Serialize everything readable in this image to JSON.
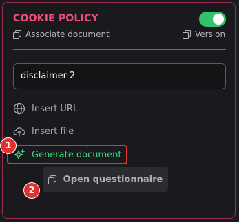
{
  "panel": {
    "title": "COOKIE POLICY",
    "toggle_on": true,
    "associate_label": "Associate document",
    "version_label": "Version",
    "document_value": "disclaimer-2"
  },
  "actions": {
    "insert_url": "Insert URL",
    "insert_file": "Insert file",
    "generate": "Generate document",
    "open_questionnaire": "Open questionnaire"
  },
  "annotations": {
    "badge_1": "1",
    "badge_2": "2"
  },
  "colors": {
    "title": "#ee4d7c",
    "toggle": "#34c26c",
    "generate": "#3fd779",
    "highlight": "#e3312f"
  },
  "icons": {
    "associate": "copy-icon",
    "version": "copy-icon",
    "insert_url": "globe-icon",
    "insert_file": "cloud-upload-icon",
    "generate": "sparkle-icon",
    "questionnaire": "copy-icon"
  }
}
